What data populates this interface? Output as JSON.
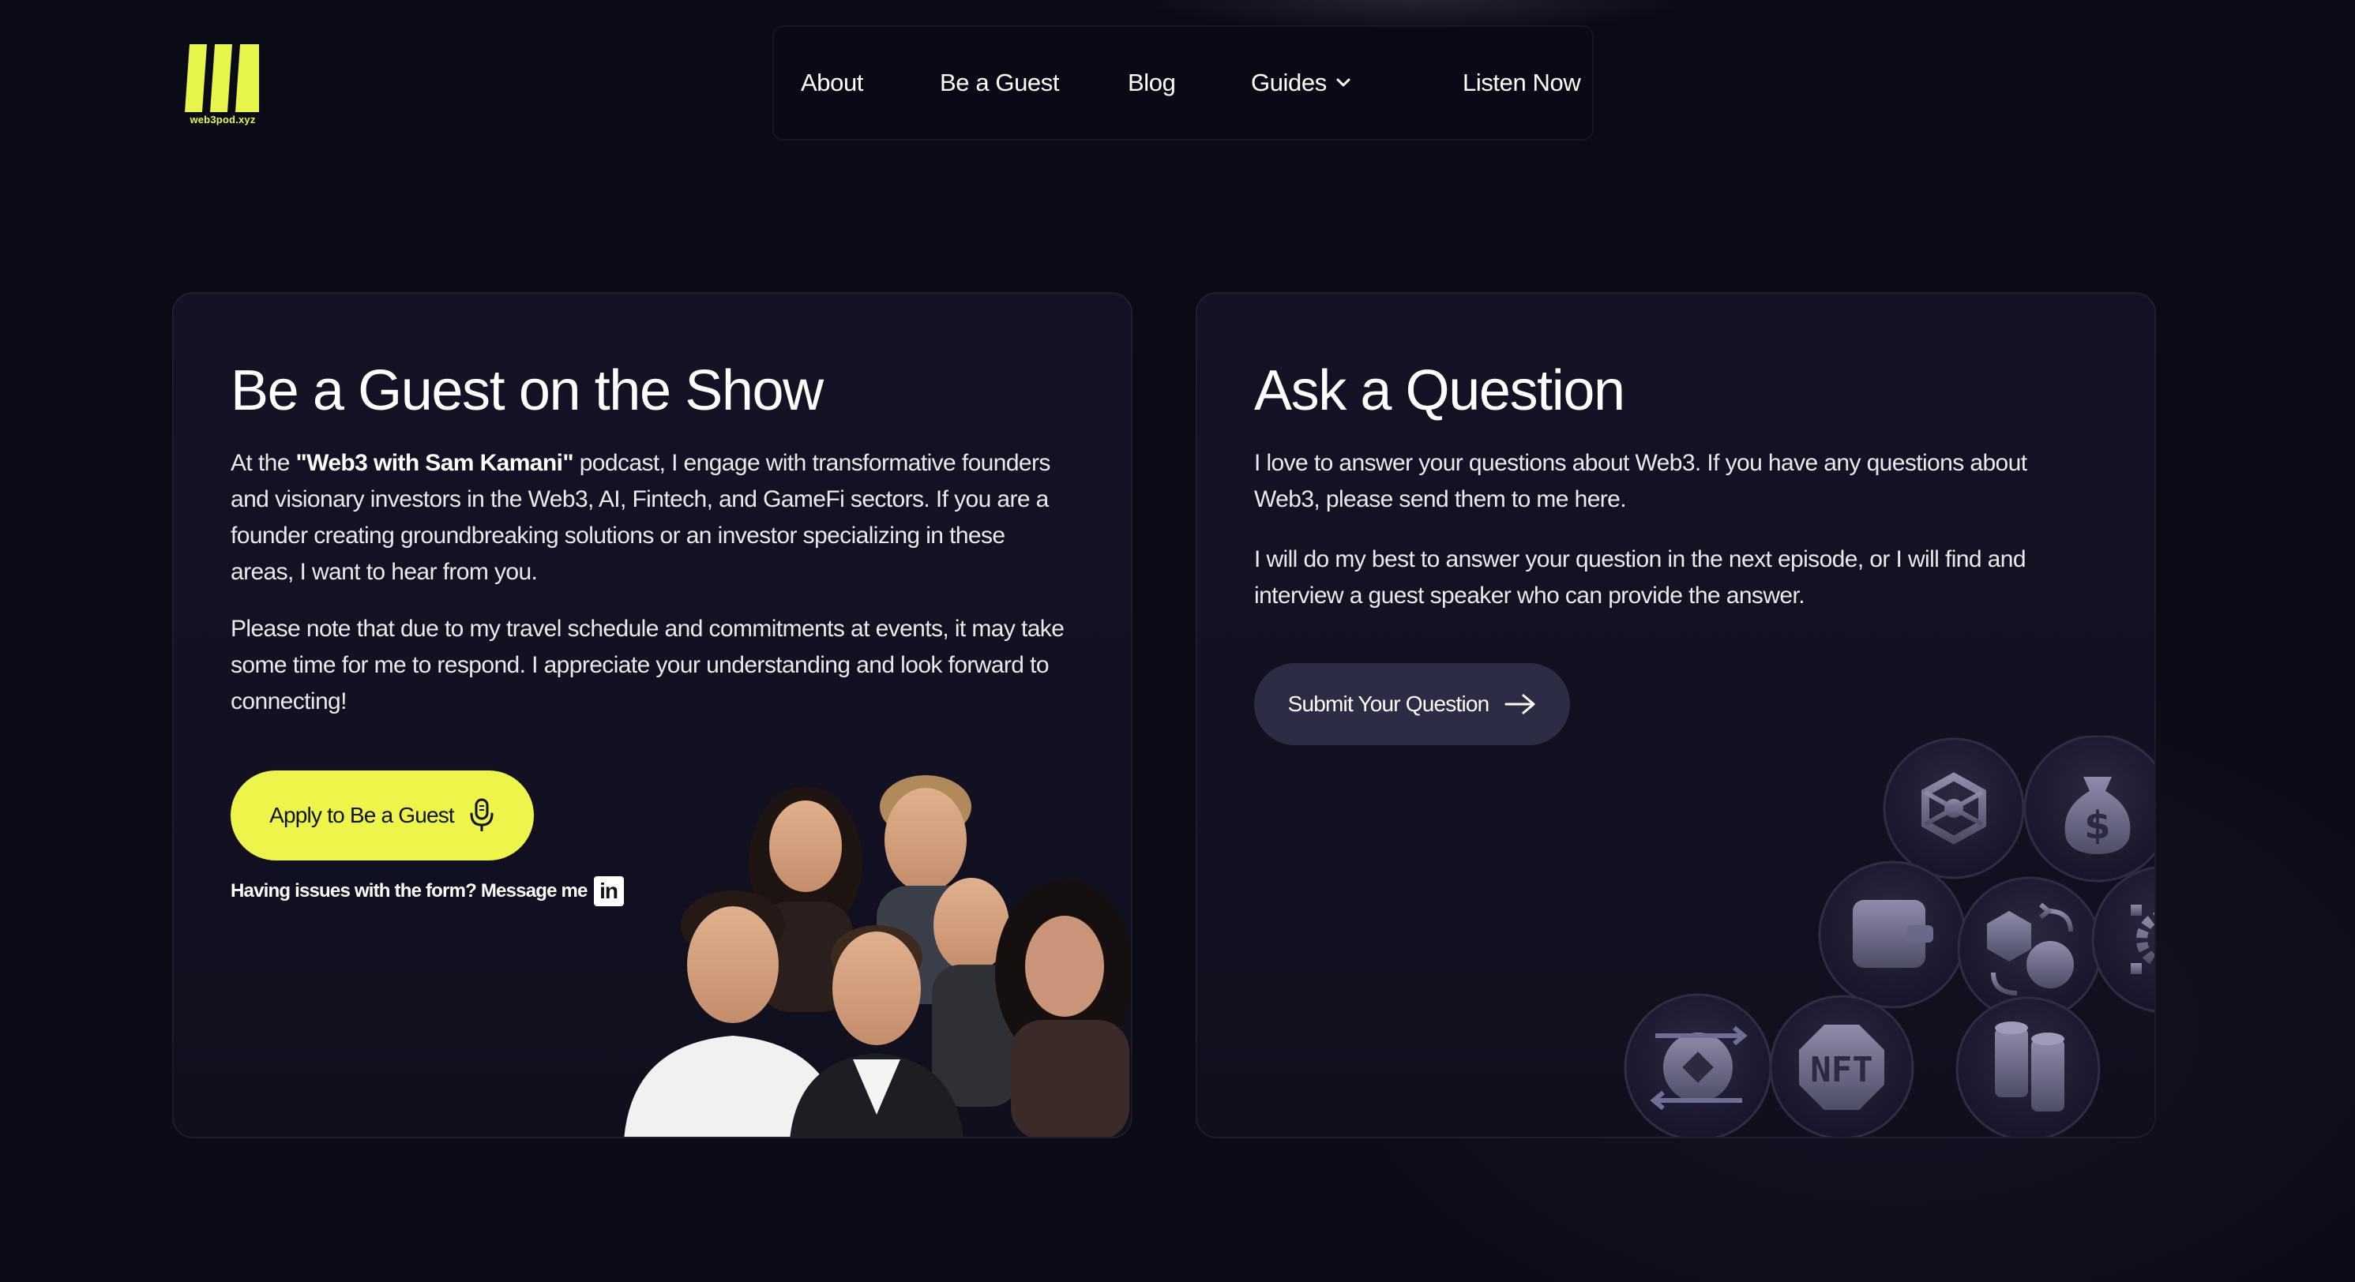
{
  "logo": {
    "text": "web3pod.xyz",
    "color": "#e6f54a"
  },
  "nav": {
    "items": [
      {
        "label": "About"
      },
      {
        "label": "Be a Guest"
      },
      {
        "label": "Blog"
      },
      {
        "label": "Guides"
      },
      {
        "label": "Listen Now"
      }
    ]
  },
  "guest_card": {
    "title": "Be a Guest on the Show",
    "para1_prefix": "At the ",
    "para1_bold": "\"Web3 with Sam Kamani\"",
    "para1_suffix": " podcast, I engage with transformative founders and visionary investors in the Web3, AI, Fintech, and GameFi sectors. If you are a founder creating groundbreaking solutions or an investor specializing in these areas, I want to hear from you.",
    "para2": "Please note that due to my travel schedule and commitments at events, it may take some time for me to respond. I appreciate your understanding and look forward to connecting!",
    "apply_label": "Apply to Be a Guest",
    "issues_text": "Having issues with the form? Message me",
    "linkedin_glyph": "in"
  },
  "question_card": {
    "title": "Ask a Question",
    "para1": "I love to answer your questions about Web3. If you have any questions about Web3, please send them to me here.",
    "para2": "I will do my best to answer your question in the next episode, or I will find and interview a guest speaker who can provide the answer.",
    "submit_label": "Submit Your Question",
    "nft_label": "NFT",
    "dollar_glyph": "$"
  },
  "colors": {
    "background": "#0b0a17",
    "accent": "#eef54a",
    "card": "#141325",
    "secondary_button": "#2d2c45"
  },
  "icons": [
    "logo-icon",
    "chevron-down-icon",
    "microphone-icon",
    "linkedin-icon",
    "arrow-right-icon",
    "network-icon",
    "money-bag-icon",
    "wallet-icon",
    "swap-icon",
    "settings-network-icon",
    "exchange-icon",
    "nft-icon",
    "coin-stack-icon"
  ]
}
